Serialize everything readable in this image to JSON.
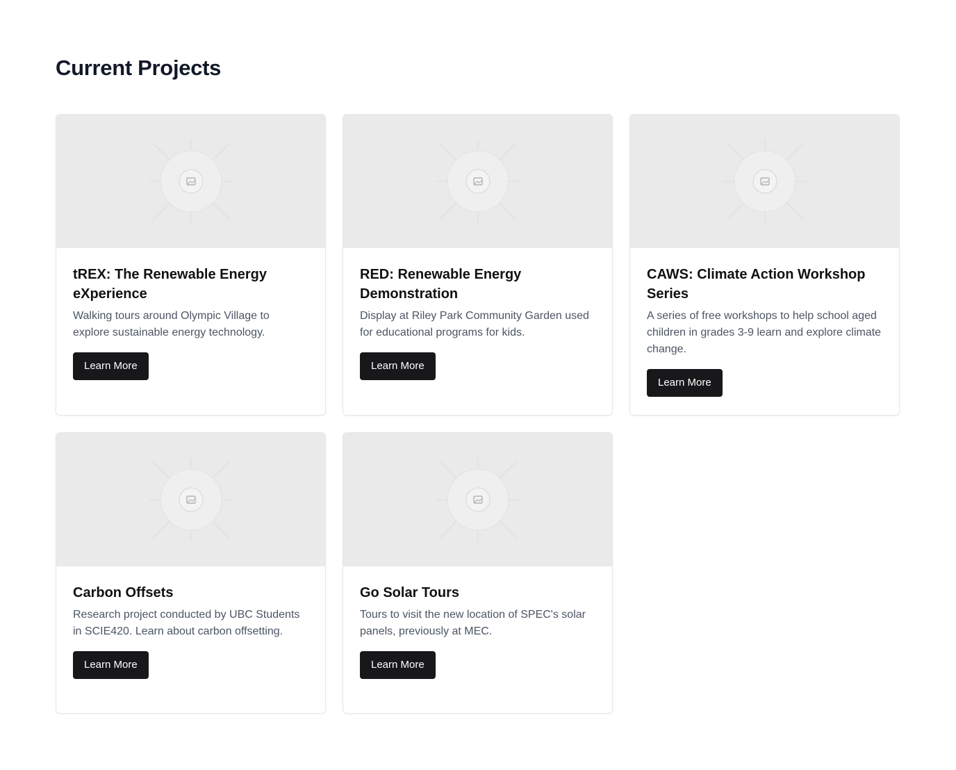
{
  "page": {
    "title": "Current Projects"
  },
  "cards": [
    {
      "title": "tREX: The Renewable Energy eXperience",
      "description": "Walking tours around Olympic Village to explore sustainable energy technology.",
      "button_label": "Learn More",
      "image_icon": "image-placeholder-icon"
    },
    {
      "title": "RED: Renewable Energy Demonstration",
      "description": "Display at Riley Park Community Garden used for educational programs for kids.",
      "button_label": "Learn More",
      "image_icon": "image-placeholder-icon"
    },
    {
      "title": "CAWS: Climate Action Workshop Series",
      "description": "A series of free workshops to help school aged children in grades 3-9 learn and explore climate change.",
      "button_label": "Learn More",
      "image_icon": "image-placeholder-icon"
    },
    {
      "title": "Carbon Offsets",
      "description": "Research project conducted by UBC Students in SCIE420. Learn about carbon offsetting.",
      "button_label": "Learn More",
      "image_icon": "image-placeholder-icon"
    },
    {
      "title": "Go Solar Tours",
      "description": "Tours to visit the new location of SPEC's solar panels, previously at MEC.",
      "button_label": "Learn More",
      "image_icon": "image-placeholder-icon"
    }
  ],
  "colors": {
    "button_bg": "#18181b",
    "placeholder_bg": "#eaeaea",
    "description_text": "#4b5563"
  }
}
